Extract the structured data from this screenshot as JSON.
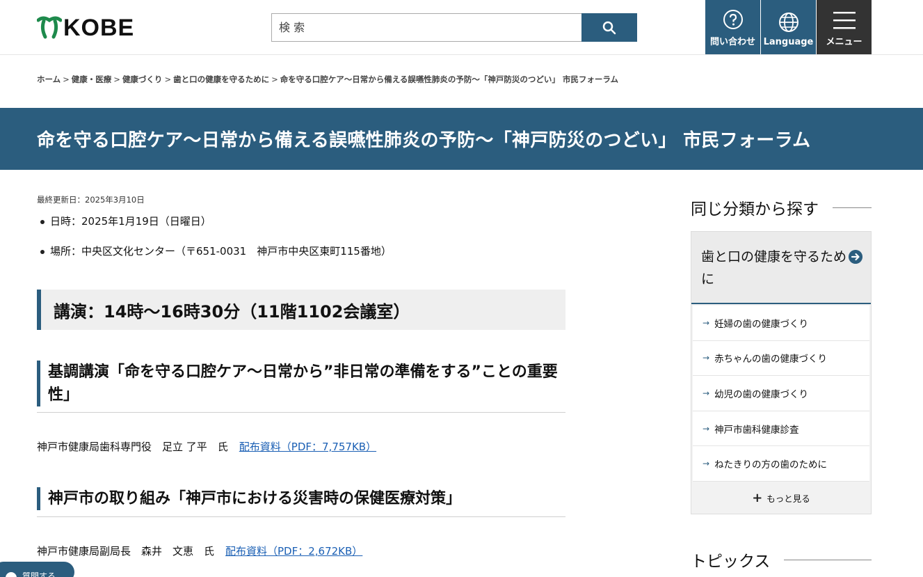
{
  "header": {
    "logo_text": "KOBE",
    "search_placeholder": "検 索",
    "contact_label": "問い合わせ",
    "language_label": "Language",
    "menu_label": "メニュー"
  },
  "breadcrumb": {
    "items": [
      "ホーム",
      "健康・医療",
      "健康づくり",
      "歯と口の健康を守るために"
    ],
    "separator": ">",
    "current": "命を守る口腔ケア〜日常から備える誤嚥性肺炎の予防〜「神戸防災のつどい」 市民フォーラム"
  },
  "page": {
    "title": "命を守る口腔ケア〜日常から備える誤嚥性肺炎の予防〜「神戸防災のつどい」 市民フォーラム",
    "updated": "最終更新日：2025年3月10日",
    "info": [
      "日時：2025年1月19日（日曜日）",
      "場所：中央区文化センター（〒651-0031　神戸市中央区東町115番地）"
    ],
    "section_heading": "講演：14時〜16時30分（11階1102会議室）",
    "talks": [
      {
        "heading": "基調講演「命を守る口腔ケア〜日常から”非日常の準備をする”ことの重要性」",
        "speaker": "神戸市健康局歯科専門役　足立 了平　氏",
        "link": "配布資料（PDF：7,757KB）"
      },
      {
        "heading": "神戸市の取り組み「神戸市における災害時の保健医療対策」",
        "speaker": "神戸市健康局副局長　森井　文恵　氏",
        "link": "配布資料（PDF：2,672KB）"
      }
    ]
  },
  "sidebar": {
    "heading": "同じ分類から探す",
    "category": "歯と口の健康を守るために",
    "items": [
      "妊婦の歯の健康づくり",
      "赤ちゃんの歯の健康づくり",
      "幼児の歯の健康づくり",
      "神戸市歯科健康診査",
      "ねたきりの方の歯のために"
    ],
    "more_label": "もっと見る",
    "topics_heading": "トピックス"
  },
  "question_tab": "質問する",
  "colors": {
    "brand": "#2b5d7e",
    "menu_bg": "#333333",
    "link": "#1a5fb4",
    "logo_green": "#1e8a4c"
  }
}
